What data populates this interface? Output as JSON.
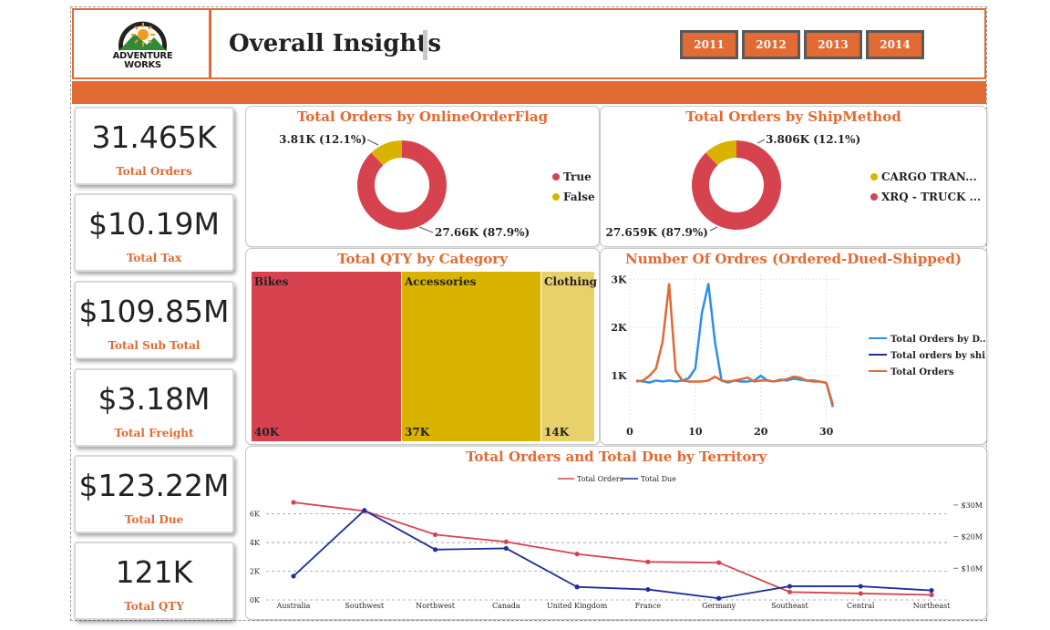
{
  "header": {
    "logo_line1": "ADVENTURE",
    "logo_line2": "WORKS",
    "title": "Overall Insights",
    "years": [
      "2011",
      "2012",
      "2013",
      "2014"
    ]
  },
  "colors": {
    "accent": "#e26a33",
    "red": "#d6434f",
    "gold": "#d9b300",
    "light_gold": "#e8d06a",
    "light_blue": "#2e8fe8",
    "dark_blue": "#1f2f9e"
  },
  "kpis": [
    {
      "value": "31.465K",
      "label": "Total Orders"
    },
    {
      "value": "$10.19M",
      "label": "Total Tax"
    },
    {
      "value": "$109.85M",
      "label": "Total Sub Total"
    },
    {
      "value": "$3.18M",
      "label": "Total Freight"
    },
    {
      "value": "$123.22M",
      "label": "Total Due"
    },
    {
      "value": "121K",
      "label": "Total QTY"
    }
  ],
  "chart_data": [
    {
      "type": "pie",
      "title": "Total Orders by OnlineOrderFlag",
      "categories": [
        "True",
        "False"
      ],
      "values": [
        27660,
        3810
      ],
      "data_labels": [
        "27.66K (87.9%)",
        "3.81K (12.1%)"
      ],
      "legend": "right"
    },
    {
      "type": "pie",
      "title": "Total Orders by ShipMethod",
      "categories": [
        "XRQ - TRUCK ...",
        "CARGO TRAN..."
      ],
      "values": [
        27659,
        3806
      ],
      "data_labels": [
        "27.659K (87.9%)",
        "3.806K (12.1%)"
      ],
      "legend_order": [
        "CARGO TRAN...",
        "XRQ - TRUCK ..."
      ],
      "legend": "right"
    },
    {
      "type": "heatmap",
      "subtype": "treemap",
      "title": "Total QTY by Category",
      "categories": [
        "Bikes",
        "Accessories",
        "Clothing"
      ],
      "values": [
        40000,
        37000,
        14000
      ],
      "data_labels": [
        "40K",
        "37K",
        "14K"
      ]
    },
    {
      "type": "line",
      "title": "Number Of Ordres (Ordered-Dued-Shipped)",
      "x": [
        1,
        2,
        3,
        4,
        5,
        6,
        7,
        8,
        9,
        10,
        11,
        12,
        13,
        14,
        15,
        16,
        17,
        18,
        19,
        20,
        21,
        22,
        23,
        24,
        25,
        26,
        27,
        28,
        29,
        30,
        31
      ],
      "xticks": [
        0,
        10,
        20,
        30
      ],
      "yticks": [
        "1K",
        "2K",
        "3K"
      ],
      "ylim": [
        0,
        3100
      ],
      "xlim": [
        0,
        32
      ],
      "legend": "right",
      "series": [
        {
          "name": "Total Orders by D...",
          "values": [
            900,
            880,
            860,
            900,
            880,
            900,
            880,
            900,
            950,
            1150,
            2300,
            2900,
            1700,
            900,
            860,
            900,
            880,
            880,
            900,
            1000,
            900,
            880,
            920,
            900,
            940,
            920,
            900,
            900,
            880,
            850,
            350
          ]
        },
        {
          "name": "Total orders by shi...",
          "values": [
            880,
            900,
            1000,
            1150,
            1700,
            2900,
            1100,
            900,
            880,
            880,
            880,
            900,
            980,
            900,
            880,
            900,
            930,
            960,
            880,
            900,
            900,
            880,
            900,
            930,
            980,
            960,
            900,
            880,
            880,
            850,
            400
          ]
        },
        {
          "name": "Total Orders",
          "values": [
            880,
            900,
            1000,
            1150,
            1700,
            2900,
            1100,
            900,
            880,
            880,
            880,
            900,
            980,
            900,
            880,
            900,
            930,
            960,
            880,
            900,
            900,
            880,
            900,
            930,
            980,
            960,
            900,
            880,
            880,
            850,
            400
          ]
        }
      ]
    },
    {
      "type": "line",
      "title": "Total Orders and Total Due by Territory",
      "categories": [
        "Australia",
        "Southwest",
        "Northwest",
        "Canada",
        "United Kingdom",
        "France",
        "Germany",
        "Southeast",
        "Central",
        "Northeast"
      ],
      "legend": "top",
      "left_ticks": [
        "0K",
        "2K",
        "4K",
        "6K"
      ],
      "left_ylim": [
        0,
        7500
      ],
      "right_ticks": [
        "$10M",
        "$20M",
        "$30M"
      ],
      "right_ylim": [
        0,
        34000000
      ],
      "series": [
        {
          "name": "Total Orders",
          "axis": "left",
          "values": [
            6800,
            6200,
            4550,
            4050,
            3200,
            2650,
            2600,
            550,
            450,
            350
          ]
        },
        {
          "name": "Total Due",
          "axis": "right",
          "values": [
            7500000,
            28300000,
            15900000,
            16300000,
            4100000,
            3300000,
            500000,
            4300000,
            4300000,
            3000000
          ]
        }
      ]
    }
  ]
}
